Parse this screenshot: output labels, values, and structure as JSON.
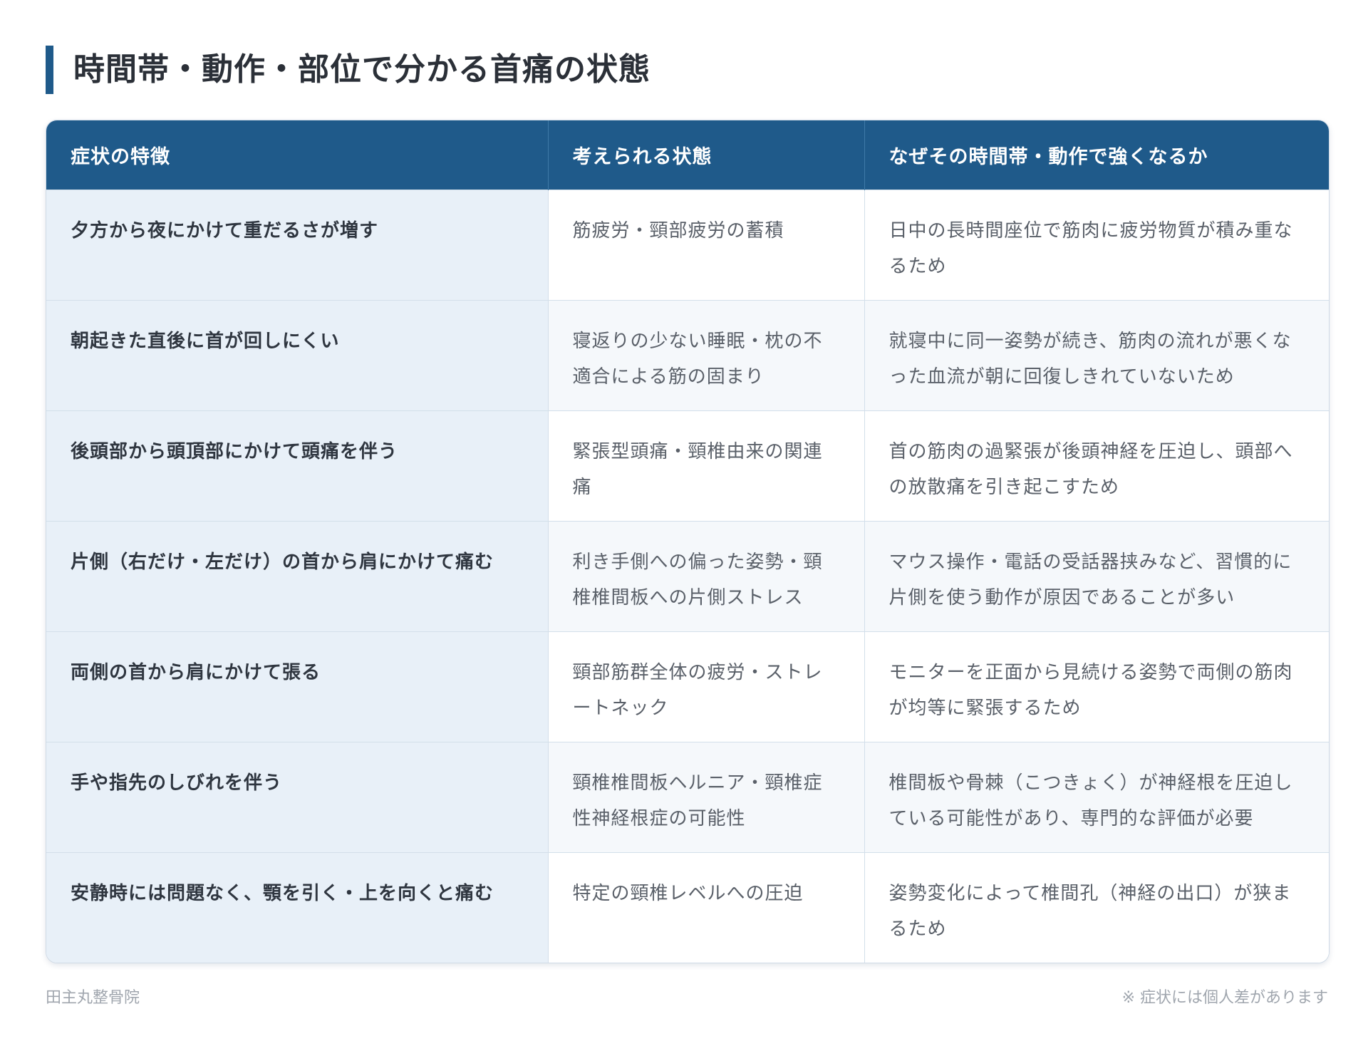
{
  "title": "時間帯・動作・部位で分かる首痛の状態",
  "table": {
    "headers": [
      "症状の特徴",
      "考えられる状態",
      "なぜその時間帯・動作で強くなるか"
    ],
    "rows": [
      [
        "夕方から夜にかけて重だるさが増す",
        "筋疲労・頸部疲労の蓄積",
        "日中の長時間座位で筋肉に疲労物質が積み重なるため"
      ],
      [
        "朝起きた直後に首が回しにくい",
        "寝返りの少ない睡眠・枕の不適合による筋の固まり",
        "就寝中に同一姿勢が続き、筋肉の流れが悪くなった血流が朝に回復しきれていないため"
      ],
      [
        "後頭部から頭頂部にかけて頭痛を伴う",
        "緊張型頭痛・頸椎由来の関連痛",
        "首の筋肉の過緊張が後頭神経を圧迫し、頭部への放散痛を引き起こすため"
      ],
      [
        "片側（右だけ・左だけ）の首から肩にかけて痛む",
        "利き手側への偏った姿勢・頸椎椎間板への片側ストレス",
        "マウス操作・電話の受話器挟みなど、習慣的に片側を使う動作が原因であることが多い"
      ],
      [
        "両側の首から肩にかけて張る",
        "頸部筋群全体の疲労・ストレートネック",
        "モニターを正面から見続ける姿勢で両側の筋肉が均等に緊張するため"
      ],
      [
        "手や指先のしびれを伴う",
        "頸椎椎間板ヘルニア・頸椎症性神経根症の可能性",
        "椎間板や骨棘（こつきょく）が神経根を圧迫している可能性があり、専門的な評価が必要"
      ],
      [
        "安静時には問題なく、顎を引く・上を向くと痛む",
        "特定の頸椎レベルへの圧迫",
        "姿勢変化によって椎間孔（神経の出口）が狭まるため"
      ]
    ]
  },
  "footer": {
    "clinic_name": "田主丸整骨院",
    "note": "※ 症状には個人差があります"
  },
  "colors": {
    "accent": "#1f5a8a",
    "symptom_cell_bg": "#e8f0f8",
    "header_text": "#ffffff"
  }
}
